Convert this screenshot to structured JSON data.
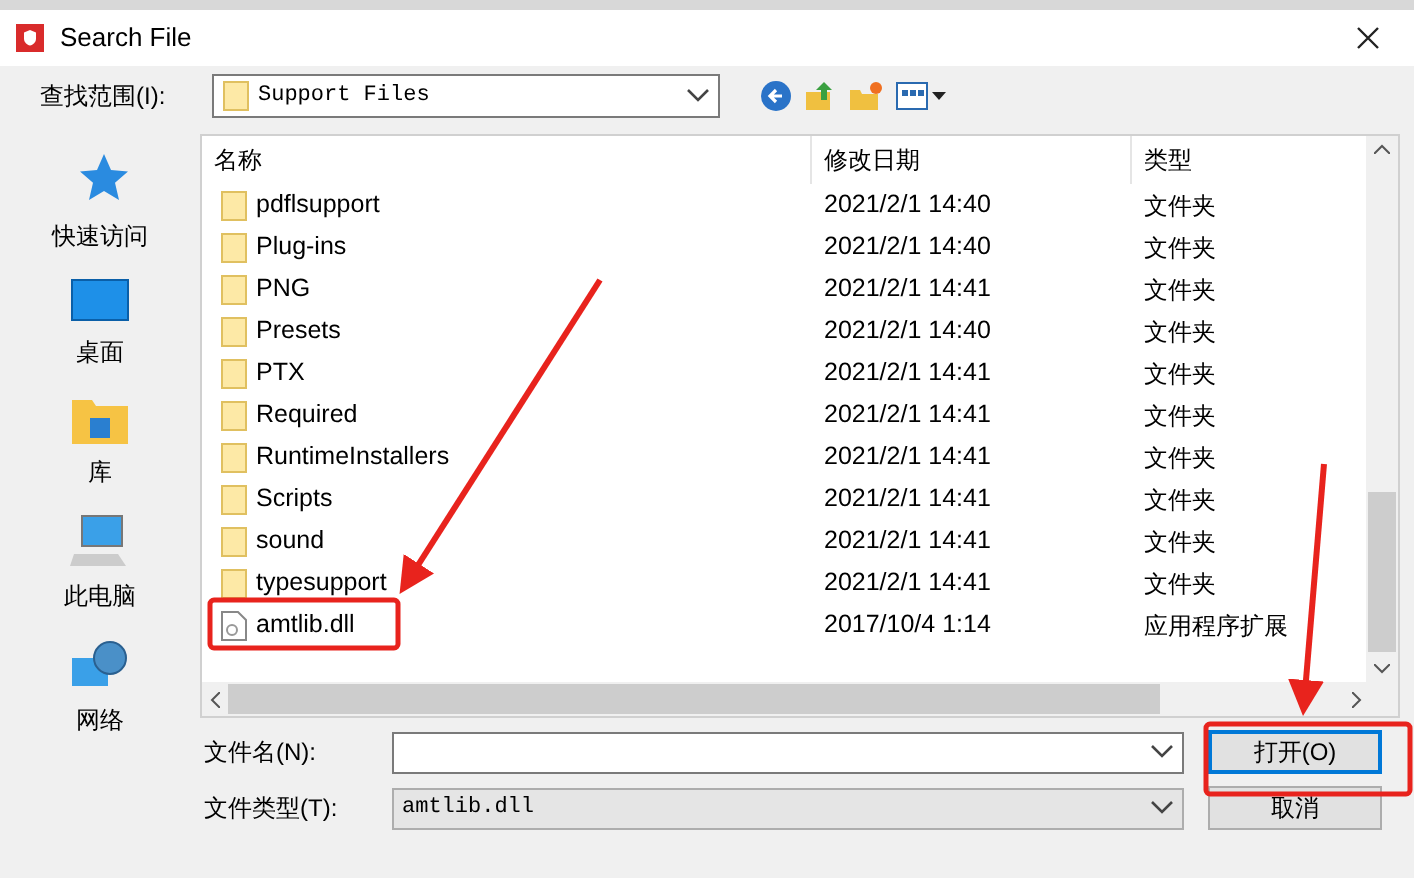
{
  "window": {
    "title": "Search File"
  },
  "look_in": {
    "label": "查找范围(I):",
    "value": "Support Files"
  },
  "sidebar": {
    "items": [
      {
        "label": "快速访问"
      },
      {
        "label": "桌面"
      },
      {
        "label": "库"
      },
      {
        "label": "此电脑"
      },
      {
        "label": "网络"
      }
    ]
  },
  "table": {
    "columns": [
      "名称",
      "修改日期",
      "类型"
    ],
    "rows": [
      {
        "kind": "folder",
        "name": "pdflsupport",
        "date": "2021/2/1 14:40",
        "type": "文件夹"
      },
      {
        "kind": "folder",
        "name": "Plug-ins",
        "date": "2021/2/1 14:40",
        "type": "文件夹"
      },
      {
        "kind": "folder",
        "name": "PNG",
        "date": "2021/2/1 14:41",
        "type": "文件夹"
      },
      {
        "kind": "folder",
        "name": "Presets",
        "date": "2021/2/1 14:40",
        "type": "文件夹"
      },
      {
        "kind": "folder",
        "name": "PTX",
        "date": "2021/2/1 14:41",
        "type": "文件夹"
      },
      {
        "kind": "folder",
        "name": "Required",
        "date": "2021/2/1 14:41",
        "type": "文件夹"
      },
      {
        "kind": "folder",
        "name": "RuntimeInstallers",
        "date": "2021/2/1 14:41",
        "type": "文件夹"
      },
      {
        "kind": "folder",
        "name": "Scripts",
        "date": "2021/2/1 14:41",
        "type": "文件夹"
      },
      {
        "kind": "folder",
        "name": "sound",
        "date": "2021/2/1 14:41",
        "type": "文件夹"
      },
      {
        "kind": "folder",
        "name": "typesupport",
        "date": "2021/2/1 14:41",
        "type": "文件夹"
      },
      {
        "kind": "file",
        "name": "amtlib.dll",
        "date": "2017/10/4 1:14",
        "type": "应用程序扩展"
      }
    ]
  },
  "file_name": {
    "label": "文件名(N):"
  },
  "file_type": {
    "label": "文件类型(T):",
    "value": "amtlib.dll"
  },
  "buttons": [
    {
      "label": "打开(O)",
      "default": true
    },
    {
      "label": "取消",
      "default": false
    }
  ]
}
